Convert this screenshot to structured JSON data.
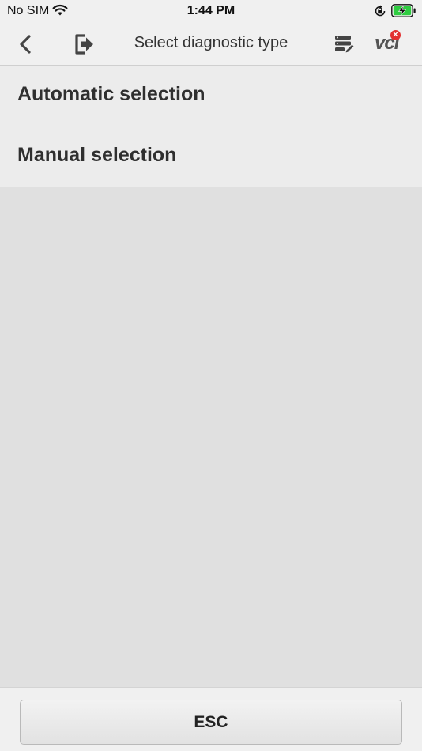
{
  "status_bar": {
    "carrier": "No SIM",
    "time": "1:44 PM",
    "icons": [
      "wifi-icon",
      "rotation-lock-icon",
      "battery-charging-icon"
    ],
    "battery_color": "#2ecc40"
  },
  "nav_bar": {
    "title": "Select diagnostic type",
    "vci_label": "vci",
    "vci_badge": "×",
    "icons": [
      "back-chevron-icon",
      "exit-icon",
      "report-icon",
      "vci-icon"
    ],
    "badge_color": "#e23030"
  },
  "options": [
    {
      "label": "Automatic selection"
    },
    {
      "label": "Manual selection"
    }
  ],
  "footer": {
    "esc_label": "ESC"
  }
}
